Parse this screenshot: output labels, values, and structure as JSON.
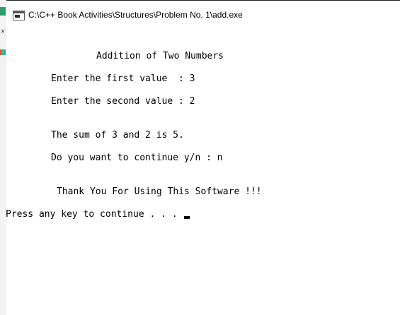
{
  "window": {
    "title": "C:\\C++ Book Activities\\Structures\\Problem No. 1\\add.exe"
  },
  "console": {
    "heading": "Addition of Two Numbers",
    "prompt_first": "Enter the first value  : 3",
    "prompt_second": "Enter the second value : 2",
    "result": "The sum of 3 and 2 is 5.",
    "continue_prompt": "Do you want to continue y/n : n",
    "thanks": "Thank You For Using This Software !!!",
    "press_key": "Press any key to continue . . . "
  },
  "icons": {
    "window_icon": "console-window-icon"
  },
  "colors": {
    "background": "#ffffff",
    "text": "#000000"
  }
}
